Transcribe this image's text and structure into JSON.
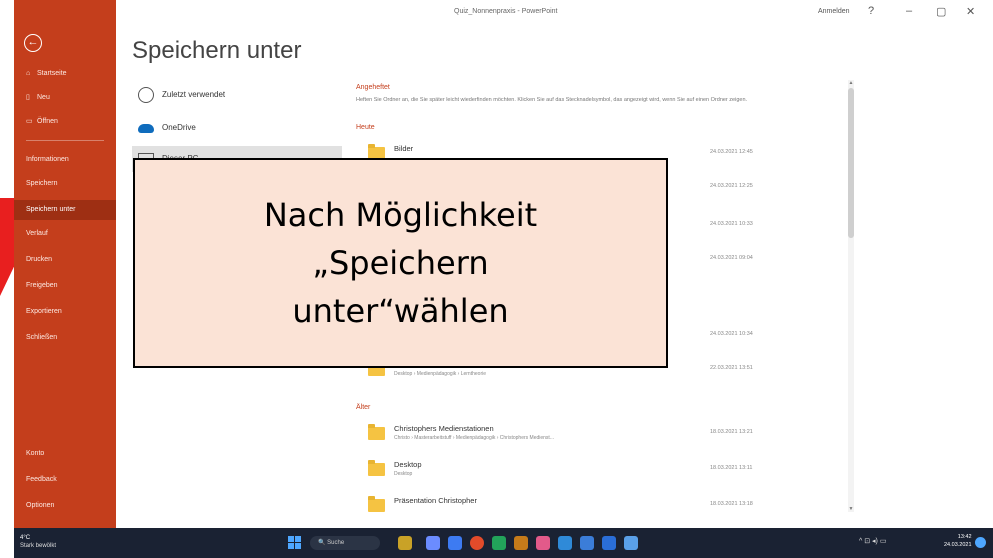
{
  "window": {
    "doc_title": "Quiz_Nonnenpraxis - PowerPoint",
    "signin": "Anmelden",
    "controls": [
      "?",
      "–",
      "▢",
      "✕"
    ]
  },
  "sidebar": {
    "back_icon": "back-arrow-icon",
    "items": [
      {
        "label": "Startseite",
        "icon": "home-icon"
      },
      {
        "label": "Neu",
        "icon": "new-icon"
      },
      {
        "label": "Öffnen",
        "icon": "open-folder-icon"
      },
      {
        "label": "Informationen",
        "icon": ""
      },
      {
        "label": "Speichern",
        "icon": ""
      },
      {
        "label": "Speichern unter",
        "icon": ""
      },
      {
        "label": "Verlauf",
        "icon": ""
      },
      {
        "label": "Drucken",
        "icon": ""
      },
      {
        "label": "Freigeben",
        "icon": ""
      },
      {
        "label": "Exportieren",
        "icon": ""
      },
      {
        "label": "Schließen",
        "icon": ""
      }
    ],
    "bottom_items": [
      {
        "label": "Konto"
      },
      {
        "label": "Feedback"
      },
      {
        "label": "Optionen"
      }
    ]
  },
  "main": {
    "title": "Speichern unter",
    "locations": [
      {
        "label": "Zuletzt verwendet",
        "icon": "clock-icon"
      },
      {
        "label": "OneDrive",
        "icon": "onedrive-cloud-icon"
      },
      {
        "label": "Dieser PC",
        "icon": "computer-icon"
      }
    ],
    "pinned_header": "Angeheftet",
    "pinned_desc": "Heften Sie Ordner an, die Sie später leicht wiederfinden möchten. Klicken Sie auf das Stecknadelsymbol, das angezeigt wird, wenn Sie auf einen Ordner zeigen.",
    "today_header": "Heute",
    "older_header": "Älter",
    "today_files": [
      {
        "name": "Bilder",
        "path": "",
        "date": "24.03.2021 12:45"
      },
      {
        "name": "",
        "path": "",
        "date": "24.03.2021 12:25"
      },
      {
        "name": "",
        "path": "",
        "date": "24.03.2021 10:33"
      },
      {
        "name": "",
        "path": "",
        "date": "24.03.2021 09:04"
      },
      {
        "name": "",
        "path": "",
        "date": "24.03.2021 10:34"
      },
      {
        "name": "",
        "path": "Desktop › Medienpädagogik › Lerntheorie",
        "date": "22.03.2021 13:51"
      }
    ],
    "older_files": [
      {
        "name": "Christophers Medienstationen",
        "path": "Christo › Masterarbeitstuff › Medienpädagogik › Christophers Medienst...",
        "date": "18.03.2021 13:21"
      },
      {
        "name": "Desktop",
        "path": "Desktop",
        "date": "18.03.2021 13:11"
      },
      {
        "name": "Präsentation Christopher",
        "path": "",
        "date": "18.03.2021 13:18"
      }
    ]
  },
  "callout": {
    "line1": "Nach Möglichkeit",
    "line2": "„Speichern",
    "line3": "unter“wählen"
  },
  "taskbar": {
    "weather_temp": "4°C",
    "weather_desc": "Stark bewölkt",
    "search_label": "Suche",
    "tray": "^  ⊡  ◂)  ▭",
    "time": "13:42",
    "date": "24.03.2021"
  },
  "colors": {
    "sidebar": "#c43e1c",
    "callout_fill": "#fbe3d6",
    "arrow": "#e81f1f",
    "taskbar": "#1a2233"
  }
}
